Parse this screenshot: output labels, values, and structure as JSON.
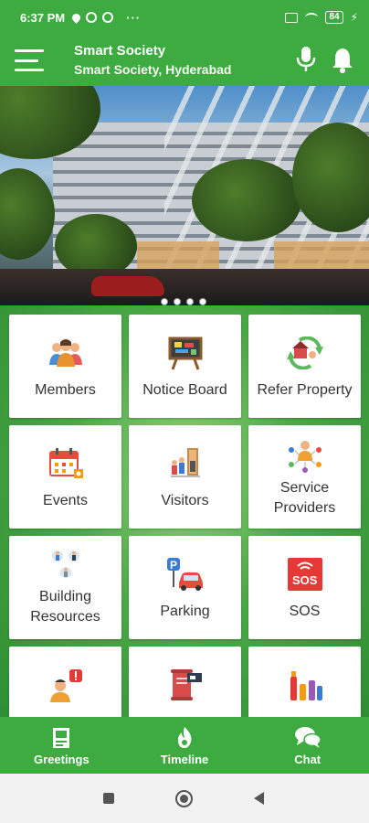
{
  "status_bar": {
    "time": "6:37 PM",
    "battery": "84",
    "more_indicator": "···"
  },
  "header": {
    "title": "Smart Society",
    "subtitle": "Smart Society, Hyderabad",
    "menu_icon": "hamburger-icon",
    "mic_icon": "microphone-icon",
    "bell_icon": "notification-bell-icon"
  },
  "banner": {
    "slides_total": 4,
    "active_slide": 1
  },
  "grid": {
    "tiles": [
      {
        "label": "Members",
        "icon": "members-icon"
      },
      {
        "label": "Notice Board",
        "icon": "notice-board-icon"
      },
      {
        "label": "Refer Property",
        "icon": "refer-property-icon"
      },
      {
        "label": "Events",
        "icon": "calendar-icon"
      },
      {
        "label": "Visitors",
        "icon": "visitors-icon"
      },
      {
        "label": "Service Providers",
        "icon": "service-providers-icon"
      },
      {
        "label": "Building Resources",
        "icon": "building-resources-icon"
      },
      {
        "label": "Parking",
        "icon": "parking-icon"
      },
      {
        "label": "SOS",
        "icon": "sos-icon"
      },
      {
        "label": "",
        "icon": "complaints-icon"
      },
      {
        "label": "",
        "icon": "bills-icon"
      },
      {
        "label": "",
        "icon": "polls-icon"
      }
    ],
    "sos_badge_text": "SOS"
  },
  "bottom_nav": {
    "items": [
      {
        "label": "Greetings",
        "icon": "greetings-icon"
      },
      {
        "label": "Timeline",
        "icon": "timeline-icon"
      },
      {
        "label": "Chat",
        "icon": "chat-icon"
      }
    ]
  },
  "colors": {
    "primary": "#3dab3f",
    "tile_bg": "#ffffff",
    "sos_red": "#e53935"
  }
}
